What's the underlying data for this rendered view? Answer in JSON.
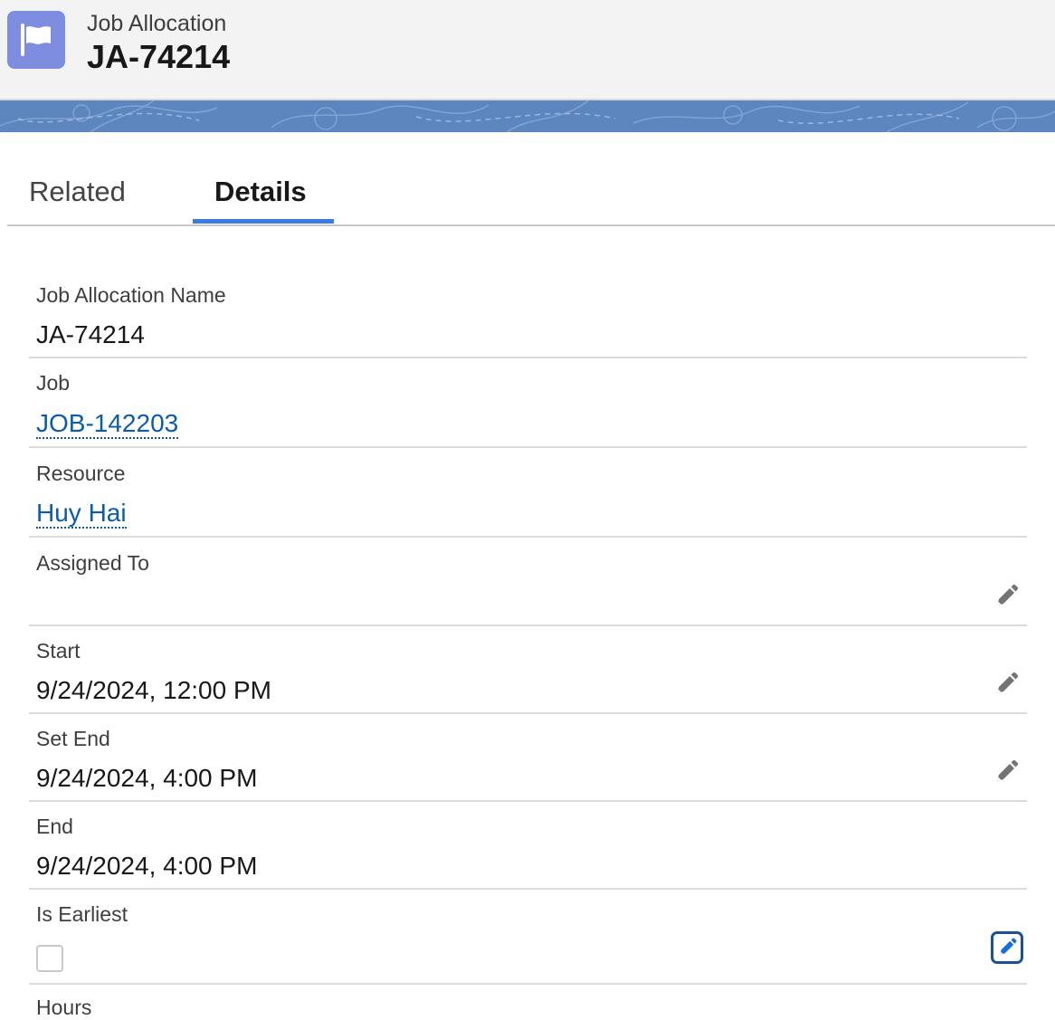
{
  "header": {
    "object_name": "Job Allocation",
    "record_title": "JA-74214",
    "icon": "flag-icon",
    "icon_color": "#7f8de1"
  },
  "banner_color": "#5d86bf",
  "tabs": [
    {
      "label": "Related",
      "active": false
    },
    {
      "label": "Details",
      "active": true
    }
  ],
  "accent_color": "#3b7ddd",
  "link_color": "#0b5cab",
  "fields": {
    "job_allocation_name": {
      "label": "Job Allocation Name",
      "value": "JA-74214"
    },
    "job": {
      "label": "Job",
      "value": "JOB-142203"
    },
    "resource": {
      "label": "Resource",
      "value": "Huy Hai"
    },
    "assigned_to": {
      "label": "Assigned To",
      "value": ""
    },
    "start": {
      "label": "Start",
      "value": "9/24/2024, 12:00 PM"
    },
    "set_end": {
      "label": "Set End",
      "value": "9/24/2024, 4:00 PM"
    },
    "end": {
      "label": "End",
      "value": "9/24/2024, 4:00 PM"
    },
    "is_earliest": {
      "label": "Is Earliest",
      "checked": false
    }
  },
  "cut_off_label": "Hours"
}
